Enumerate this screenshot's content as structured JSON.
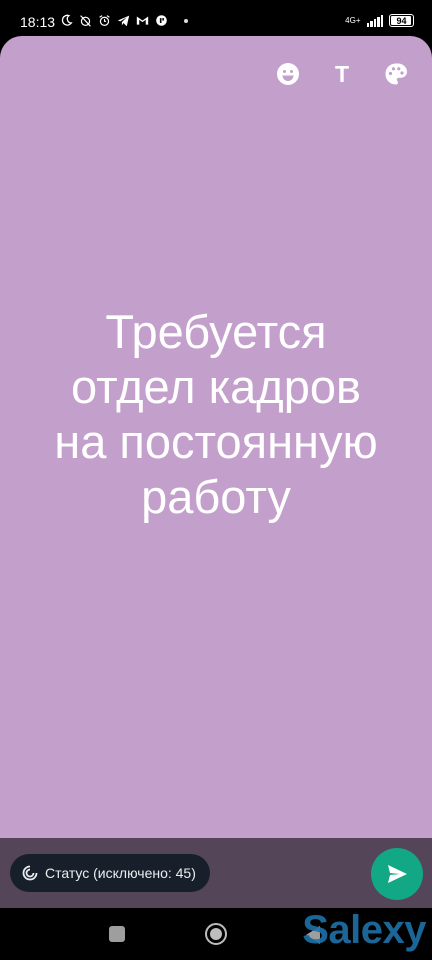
{
  "status_bar": {
    "time": "18:13",
    "network": "4G+",
    "battery": "94",
    "battery_level": 0.94
  },
  "editor": {
    "background_color": "#C39FCB",
    "tools": [
      {
        "icon": "emoji-icon"
      },
      {
        "icon": "text-icon",
        "label": "T"
      },
      {
        "icon": "palette-icon"
      }
    ],
    "status_text": "Требуется\nотдел кадров\nна постоянную\nработу"
  },
  "footer": {
    "audience_label": "Статус (исключено: 45)",
    "send_icon": "send-icon"
  },
  "watermark": "Salexy",
  "colors": {
    "accent": "#13A885",
    "panel": "#554558",
    "chip": "#17202A"
  }
}
